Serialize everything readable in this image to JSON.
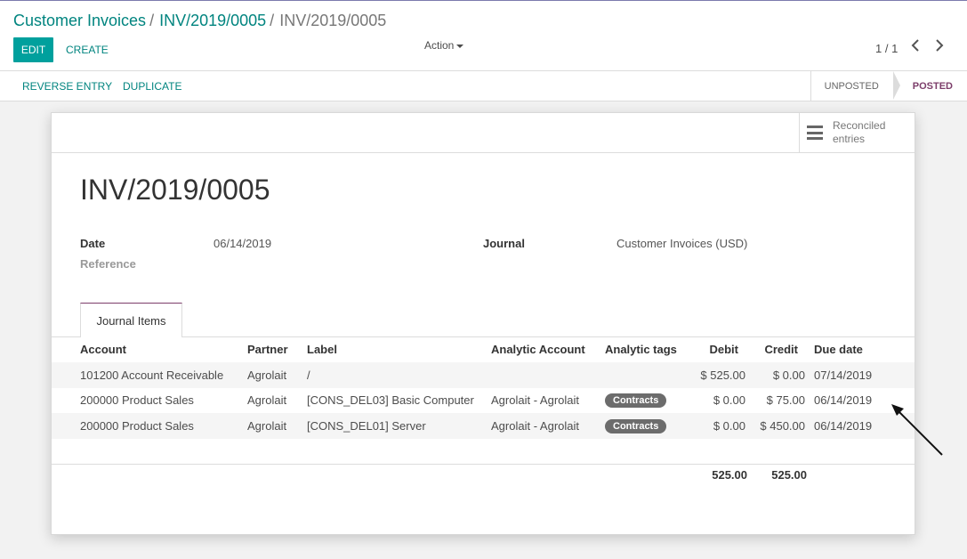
{
  "breadcrumb": {
    "items": [
      "Customer Invoices",
      "INV/2019/0005",
      "INV/2019/0005"
    ],
    "separator": "/"
  },
  "control_panel": {
    "edit_label": "EDIT",
    "create_label": "CREATE",
    "action_label": "Action",
    "pager_label": "1 / 1"
  },
  "statusbar": {
    "reverse_label": "REVERSE ENTRY",
    "duplicate_label": "DUPLICATE",
    "states": [
      "UNPOSTED",
      "POSTED"
    ],
    "active_state": "POSTED"
  },
  "button_box": {
    "reconciled_label": "Reconciled entries"
  },
  "form": {
    "title": "INV/2019/0005",
    "date_label": "Date",
    "date_value": "06/14/2019",
    "reference_label": "Reference",
    "journal_label": "Journal",
    "journal_value": "Customer Invoices (USD)"
  },
  "tabs": [
    {
      "label": "Journal Items",
      "active": true
    }
  ],
  "journal_items": {
    "columns": [
      "Account",
      "Partner",
      "Label",
      "Analytic Account",
      "Analytic tags",
      "Debit",
      "Credit",
      "Due date"
    ],
    "rows": [
      {
        "account": "101200 Account Receivable",
        "partner": "Agrolait",
        "label": "/",
        "analytic_account": "",
        "tag": "",
        "debit": "$ 525.00",
        "credit": "$ 0.00",
        "due_date": "07/14/2019"
      },
      {
        "account": "200000 Product Sales",
        "partner": "Agrolait",
        "label": "[CONS_DEL03] Basic Computer",
        "analytic_account": "Agrolait - Agrolait",
        "tag": "Contracts",
        "debit": "$ 0.00",
        "credit": "$ 75.00",
        "due_date": "06/14/2019"
      },
      {
        "account": "200000 Product Sales",
        "partner": "Agrolait",
        "label": "[CONS_DEL01] Server",
        "analytic_account": "Agrolait - Agrolait",
        "tag": "Contracts",
        "debit": "$ 0.00",
        "credit": "$ 450.00",
        "due_date": "06/14/2019"
      }
    ],
    "total_debit": "525.00",
    "total_credit": "525.00"
  },
  "colors": {
    "primary": "#00a09d",
    "link": "#00847f",
    "posted": "#7c3d6a",
    "tag": "#6c6c6c"
  }
}
